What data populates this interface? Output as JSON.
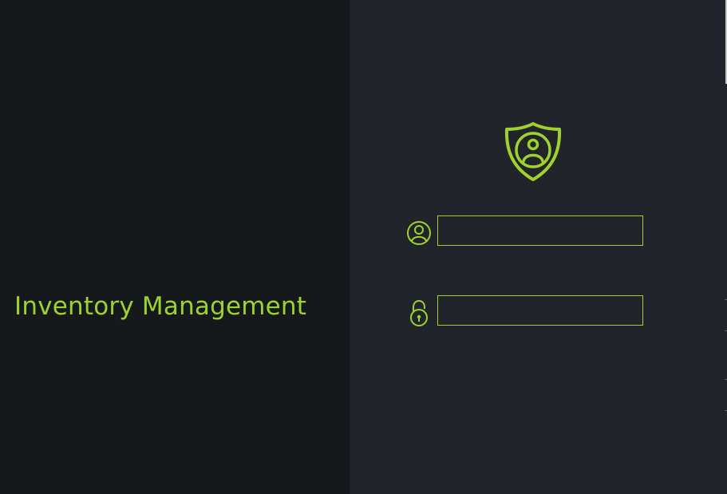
{
  "app": {
    "title": "Inventory Management"
  },
  "login": {
    "logo_icon": "shield-user-icon",
    "username": {
      "icon": "user-circle-icon",
      "value": "",
      "placeholder": ""
    },
    "password": {
      "icon": "lock-icon",
      "value": "",
      "placeholder": ""
    }
  },
  "colors": {
    "accent": "#9fd22c",
    "left_background": "#16191c",
    "right_background": "#21252b"
  }
}
